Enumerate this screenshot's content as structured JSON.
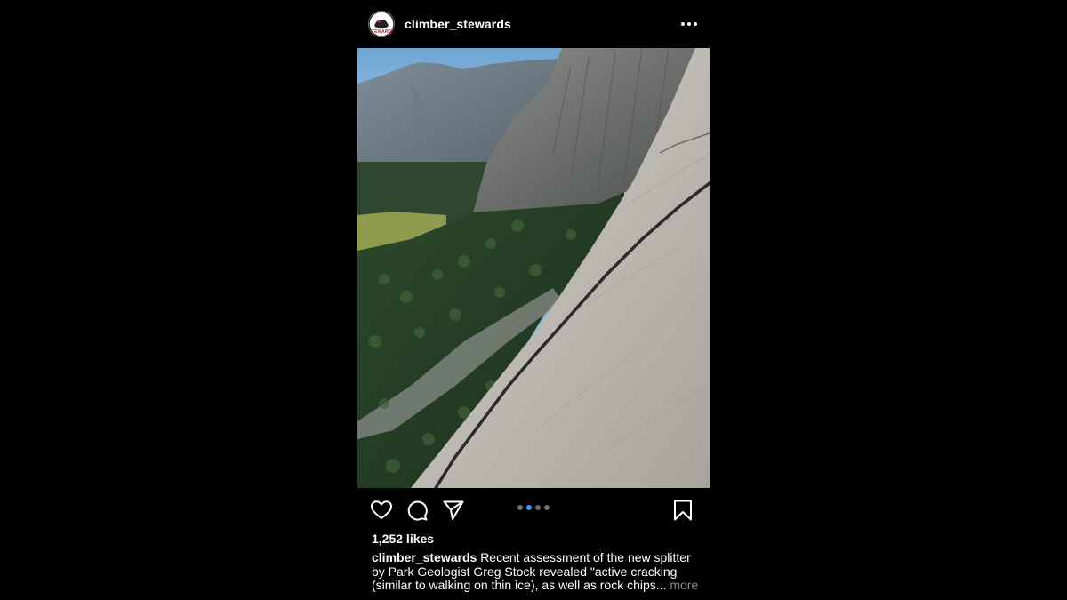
{
  "post": {
    "username": "climber_stewards",
    "avatar_icon": "climber-stewards-logo",
    "more_icon": "ellipsis-horizontal-icon",
    "image_alt": "Granite wall with a long diagonal crack above a forested valley",
    "carousel": {
      "count": 4,
      "active_index": 1
    },
    "likes": "1,252 likes",
    "caption_text": "Recent assessment of the new splitter by Park Geologist Greg Stock revealed \"active cracking (similar to walking on thin ice), as well as rock chips...",
    "caption_more": "more"
  },
  "actions": {
    "like_icon": "heart-icon",
    "comment_icon": "comment-icon",
    "share_icon": "send-icon",
    "save_icon": "bookmark-icon"
  },
  "colors": {
    "background": "#000000",
    "text": "#ffffff",
    "muted": "#8e8e8e",
    "carousel_active": "#3d94f1",
    "carousel_inactive": "#6f6f6f"
  }
}
